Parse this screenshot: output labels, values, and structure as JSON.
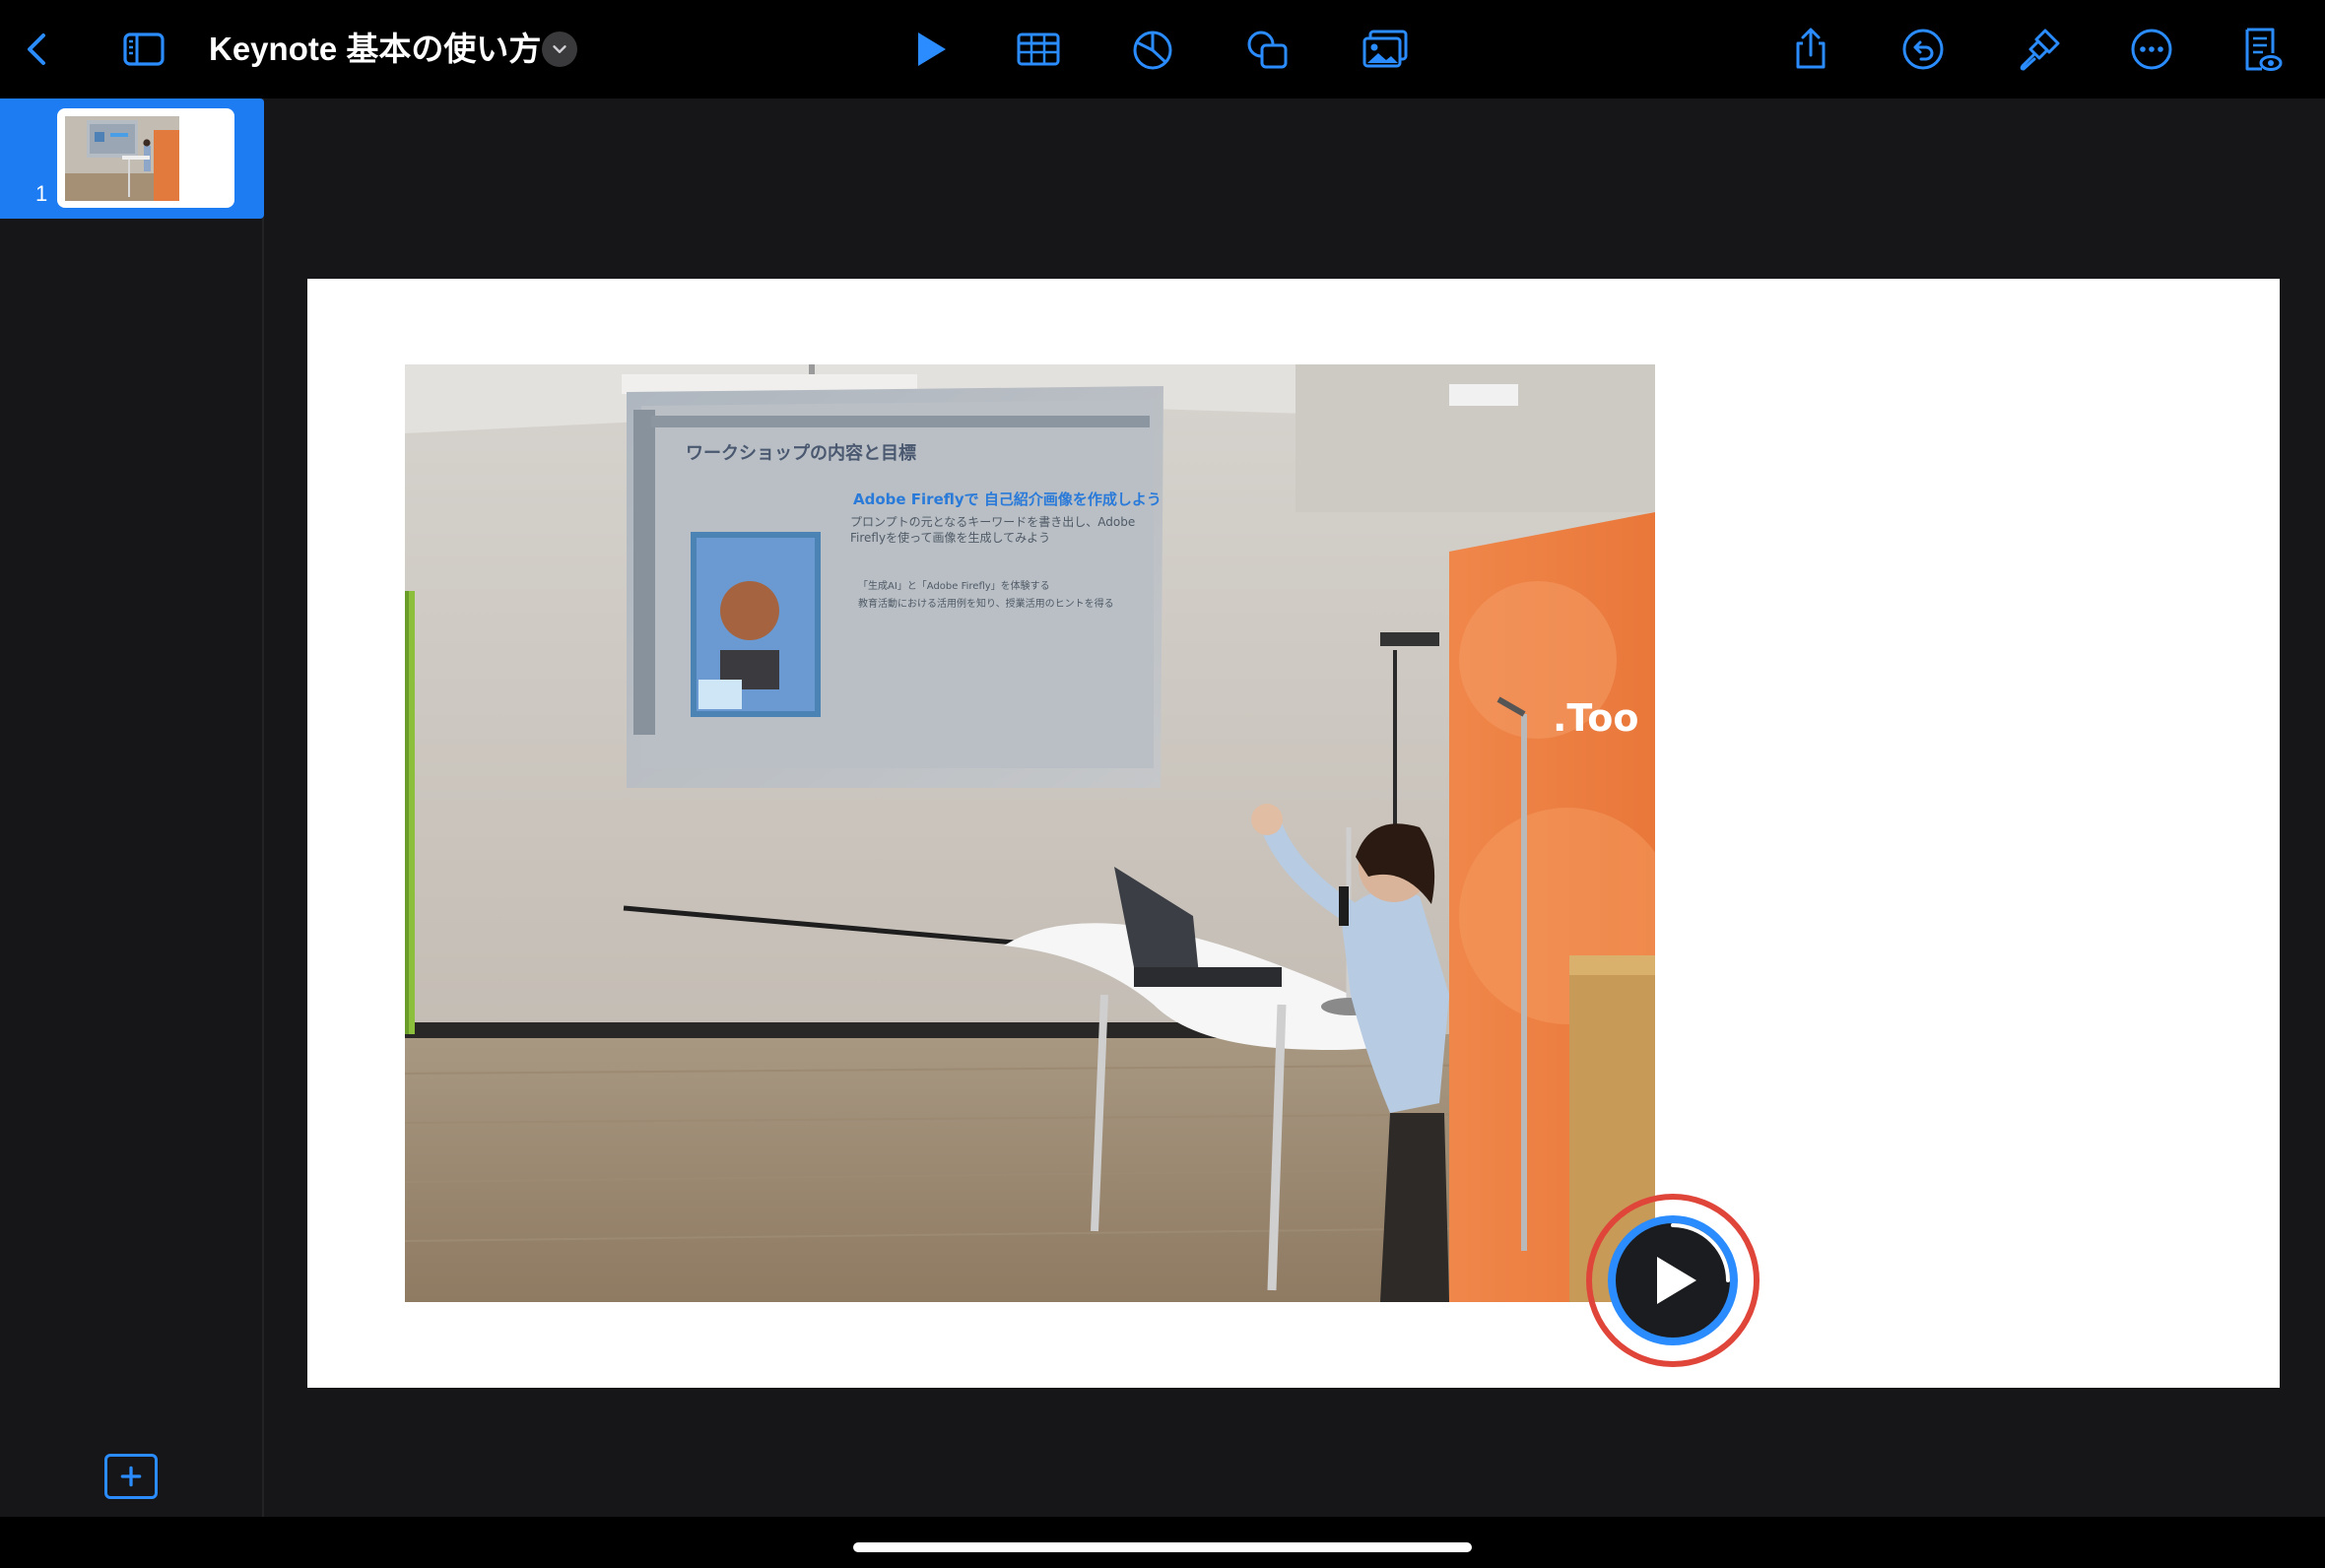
{
  "toolbar": {
    "title": "Keynote 基本の使い方",
    "left_icons": [
      "back-chevron-icon",
      "sidebar-toggle-icon"
    ],
    "center_icons": [
      "play-icon",
      "table-icon",
      "chart-icon",
      "shapes-icon",
      "media-icon"
    ],
    "right_icons": [
      "share-icon",
      "undo-icon",
      "format-brush-icon",
      "more-icon",
      "presenter-notes-icon"
    ]
  },
  "navigator": {
    "slides": [
      {
        "number": "1"
      }
    ]
  },
  "slide": {
    "photo": {
      "screen_title": "ワークショップの内容と目標",
      "screen_heading": "Adobe Fireflyで 自己紹介画像を作成しよう",
      "screen_body": "プロンプトの元となるキーワードを書き出し、Adobe Fireflyを使って画像を生成してみよう",
      "screen_bullets": [
        "「生成AI」と「Adobe Firefly」を体験する",
        "教育活動における活用例を知り、授業活用のヒントを得る"
      ],
      "banner_text": ".Too"
    }
  },
  "colors": {
    "accent": "#1d7cf2",
    "icon": "#2a8cff",
    "highlight_ring": "#e0453a",
    "background": "#161618"
  }
}
